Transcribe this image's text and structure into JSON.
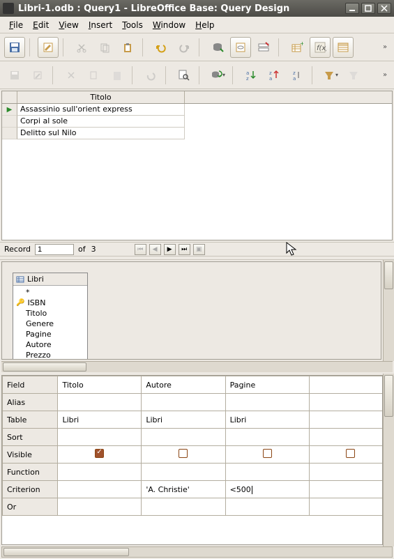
{
  "window": {
    "title": "Libri-1.odb : Query1 - LibreOffice Base: Query Design"
  },
  "menubar": {
    "items": [
      {
        "label": "File",
        "u": "F"
      },
      {
        "label": "Edit",
        "u": "E"
      },
      {
        "label": "View",
        "u": "V"
      },
      {
        "label": "Insert",
        "u": "I"
      },
      {
        "label": "Tools",
        "u": "T"
      },
      {
        "label": "Window",
        "u": "W"
      },
      {
        "label": "Help",
        "u": "H"
      }
    ]
  },
  "datagrid": {
    "column_header": "Titolo",
    "rows": [
      "Assassinio sull'orient express",
      "Corpi al sole",
      "Delitto sul Nilo"
    ]
  },
  "recnav": {
    "label_record": "Record",
    "current": "1",
    "label_of": "of",
    "total": "3"
  },
  "tablebox": {
    "title": "Libri",
    "fields": [
      "*",
      "ISBN",
      "Titolo",
      "Genere",
      "Pagine",
      "Autore",
      "Prezzo"
    ],
    "key_field_index": 1
  },
  "qgrid": {
    "row_labels": [
      "Field",
      "Alias",
      "Table",
      "Sort",
      "Visible",
      "Function",
      "Criterion",
      "Or"
    ],
    "columns": [
      {
        "field": "Titolo",
        "alias": "",
        "table": "Libri",
        "sort": "",
        "visible": true,
        "function": "",
        "criterion": "",
        "or": ""
      },
      {
        "field": "Autore",
        "alias": "",
        "table": "Libri",
        "sort": "",
        "visible": false,
        "function": "",
        "criterion": "'A. Christie'",
        "or": ""
      },
      {
        "field": "Pagine",
        "alias": "",
        "table": "Libri",
        "sort": "",
        "visible": false,
        "function": "",
        "criterion": "<500",
        "or": ""
      },
      {
        "field": "",
        "alias": "",
        "table": "",
        "sort": "",
        "visible": false,
        "function": "",
        "criterion": "",
        "or": ""
      }
    ]
  }
}
